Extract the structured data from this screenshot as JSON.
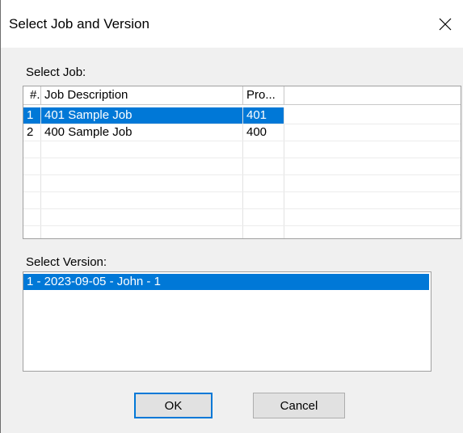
{
  "window": {
    "title": "Select Job and Version"
  },
  "jobs": {
    "label": "Select Job:",
    "columns": [
      "#.",
      "Job Description",
      "Pro..."
    ],
    "rows": [
      {
        "num": "1",
        "description": "401 Sample Job",
        "pro": "401",
        "selected": true
      },
      {
        "num": "2",
        "description": "400 Sample Job",
        "pro": "400",
        "selected": false
      }
    ]
  },
  "versions": {
    "label": "Select Version:",
    "items": [
      {
        "text": "1 - 2023-09-05 - John - 1",
        "selected": true
      }
    ]
  },
  "buttons": {
    "ok_label": "OK",
    "cancel_label": "Cancel"
  },
  "colors": {
    "selection": "#0078d7",
    "dialog_bg": "#f0f0f0"
  },
  "icons": {
    "close": "close-icon"
  }
}
